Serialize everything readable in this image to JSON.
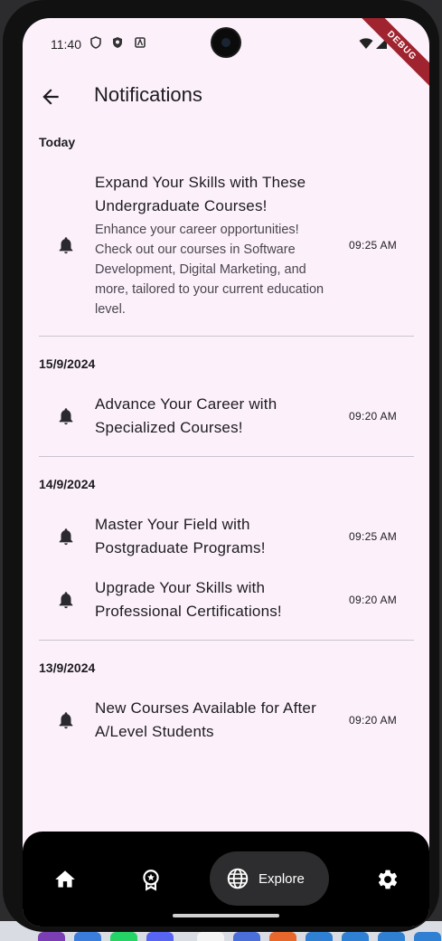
{
  "status_bar": {
    "time": "11:40",
    "debug_banner": "DEBUG"
  },
  "app_bar": {
    "title": "Notifications"
  },
  "sections": [
    {
      "date": "Today",
      "items": [
        {
          "title": "Expand Your Skills with These Undergraduate Courses!",
          "body": "Enhance your career opportunities! Check out our courses in Software Development, Digital Marketing, and more, tailored to your current education level.",
          "time": "09:25 AM",
          "icon": "bell-icon"
        }
      ]
    },
    {
      "date": "15/9/2024",
      "items": [
        {
          "title": "Advance Your Career with Specialized Courses!",
          "time": "09:20 AM",
          "icon": "bell-icon"
        }
      ]
    },
    {
      "date": "14/9/2024",
      "items": [
        {
          "title": "Master Your Field with Postgraduate Programs!",
          "time": "09:25 AM",
          "icon": "bell-icon"
        },
        {
          "title": "Upgrade Your Skills with Professional Certifications!",
          "time": "09:20 AM",
          "icon": "bell-icon"
        }
      ]
    },
    {
      "date": "13/9/2024",
      "items": [
        {
          "title": "New Courses Available for After A/Level Students",
          "time": "09:20 AM",
          "icon": "bell-icon"
        }
      ]
    }
  ],
  "bottom_nav": {
    "items": [
      {
        "icon": "home-icon"
      },
      {
        "icon": "award-badge-icon"
      },
      {
        "icon": "globe-icon",
        "label": "Explore",
        "selected": true
      },
      {
        "icon": "gear-icon"
      }
    ]
  },
  "colors": {
    "background": "#fcf1fb",
    "nav_background": "#000000",
    "text": "#1d1b20",
    "debug_banner": "#a0242f"
  }
}
